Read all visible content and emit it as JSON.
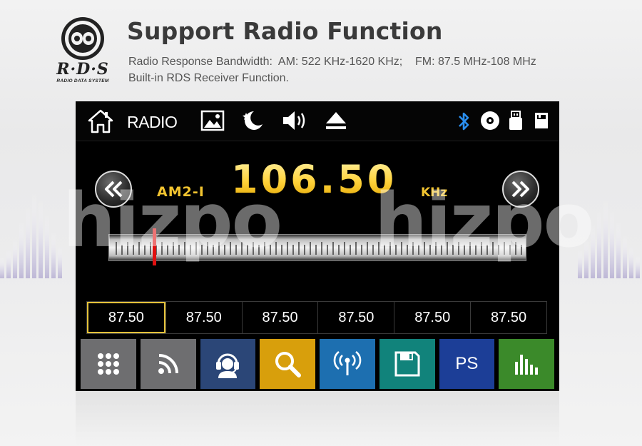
{
  "header": {
    "logo_letters": "R·D·S",
    "logo_subtitle": "RADIO DATA SYSTEM",
    "title": "Support Radio Function",
    "spec_line_1": "Radio Response Bandwidth:  AM: 522 KHz-1620 KHz;    FM: 87.5 MHz-108 MHz",
    "spec_line_2": "Built-in RDS Receiver Function."
  },
  "watermark": [
    "hizpo",
    "hizpo"
  ],
  "topbar": {
    "home_icon": "home-icon",
    "label": "RADIO",
    "icons": [
      "picture-icon",
      "night-mode-icon",
      "volume-icon",
      "eject-icon",
      "bluetooth-icon",
      "disc-icon",
      "usb-icon",
      "sd-card-icon"
    ]
  },
  "tuner": {
    "band": "AM2-I",
    "frequency": "106.50",
    "unit": "KHz",
    "needle_position_fraction": 0.11
  },
  "presets": [
    {
      "label": "87.50",
      "active": true
    },
    {
      "label": "87.50",
      "active": false
    },
    {
      "label": "87.50",
      "active": false
    },
    {
      "label": "87.50",
      "active": false
    },
    {
      "label": "87.50",
      "active": false
    },
    {
      "label": "87.50",
      "active": false
    }
  ],
  "function_buttons": [
    {
      "icon": "grid-menu-icon",
      "color": "#6e6e70"
    },
    {
      "icon": "rss-feed-icon",
      "color": "#6e6e70"
    },
    {
      "icon": "headset-agent-icon",
      "color": "#2b4677"
    },
    {
      "icon": "search-icon",
      "color": "#d89f0c"
    },
    {
      "icon": "antenna-signal-icon",
      "color": "#1d6fb0"
    },
    {
      "icon": "save-icon",
      "color": "#11837b"
    },
    {
      "icon": "ps-icon",
      "label": "PS",
      "color": "#1c3e97"
    },
    {
      "icon": "equalizer-icon",
      "color": "#3b8a2a"
    }
  ],
  "colors": {
    "frequency": "#ffd64a",
    "needle": "#e01010",
    "bluetooth": "#2a8ff0",
    "preset_active_border": "#e5c23a"
  }
}
